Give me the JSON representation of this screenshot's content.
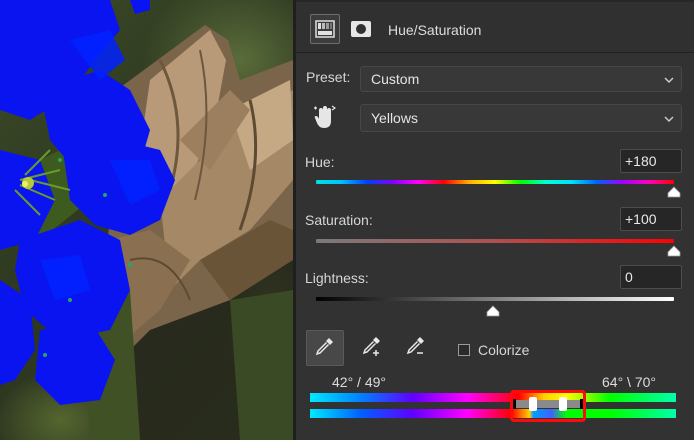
{
  "header": {
    "title": "Hue/Saturation"
  },
  "preset": {
    "label": "Preset:",
    "value": "Custom"
  },
  "channel": {
    "value": "Yellows"
  },
  "hue": {
    "label": "Hue:",
    "value": "+180",
    "fraction": 1.0
  },
  "saturation": {
    "label": "Saturation:",
    "value": "+100",
    "fraction": 1.0
  },
  "lightness": {
    "label": "Lightness:",
    "value": "0",
    "fraction": 0.5
  },
  "colorize": {
    "label": "Colorize",
    "checked": false
  },
  "range": {
    "left": "42° / 49°",
    "right": "64° \\ 70°"
  },
  "colors": {
    "highlight": "#ff0a0a",
    "panel_bg": "#323232",
    "field_bg": "#262626"
  },
  "icons": [
    "adjustment-layer-icon",
    "mask-icon",
    "hand-pointer-icon",
    "chevron-down-icon",
    "eyedropper-icon",
    "eyedropper-add-icon",
    "eyedropper-subtract-icon"
  ]
}
